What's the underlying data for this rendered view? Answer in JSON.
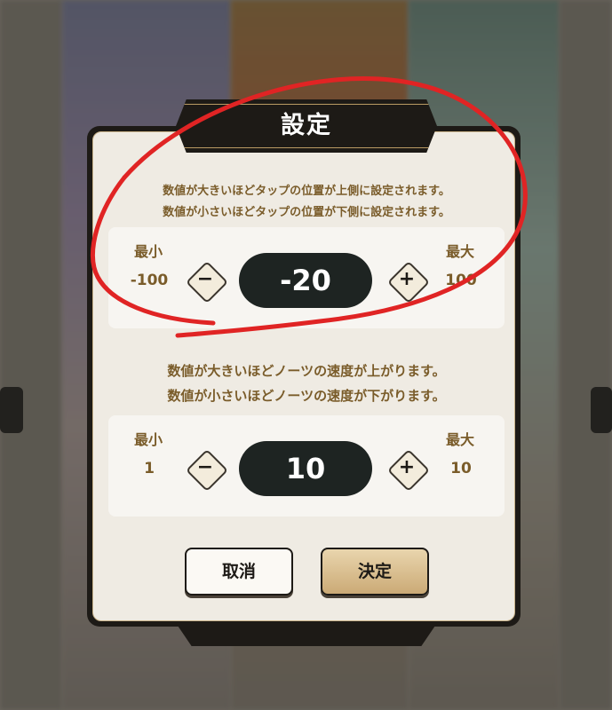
{
  "dialog": {
    "title": "設定",
    "offset": {
      "description_line1": "数値が大きいほどタップの位置が上側に設定されます。",
      "description_line2": "数値が小さいほどタップの位置が下側に設定されます。",
      "min_label": "最小",
      "min_value": "-100",
      "max_label": "最大",
      "max_value": "100",
      "value": "-20",
      "minus": "−",
      "plus": "+"
    },
    "speed": {
      "description_line1": "数値が大きいほどノーツの速度が上がります。",
      "description_line2": "数値が小さいほどノーツの速度が下がります。",
      "min_label": "最小",
      "min_value": "1",
      "max_label": "最大",
      "max_value": "10",
      "value": "10",
      "minus": "−",
      "plus": "+"
    },
    "buttons": {
      "cancel": "取消",
      "confirm": "決定"
    }
  },
  "colors": {
    "accent_text": "#7a5c2a",
    "value_pill": "#1e2422",
    "confirm_button": "#cbaa76",
    "annotation_circle": "#e02424"
  },
  "icons": [
    "minus-icon",
    "plus-icon"
  ]
}
